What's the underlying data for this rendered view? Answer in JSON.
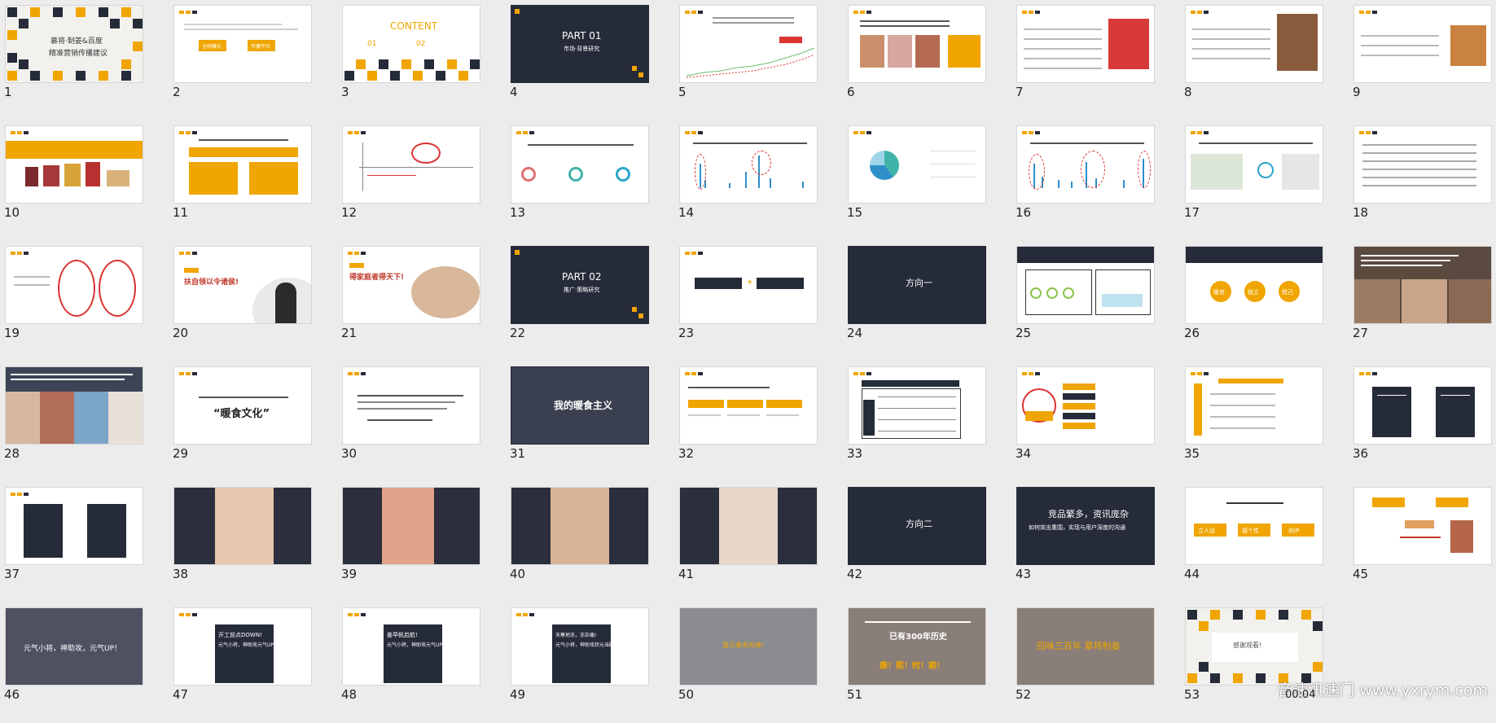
{
  "slides": [
    {
      "n": "1",
      "title": "慕将·制姜&百度",
      "subtitle": "精准营销传播建议"
    },
    {
      "n": "2",
      "a": "全网曝光",
      "b": "传播平台"
    },
    {
      "n": "3",
      "title": "CONTENT",
      "i1": "01",
      "i2": "02"
    },
    {
      "n": "4",
      "title": "PART 01",
      "subtitle": "市场·背景研究"
    },
    {
      "n": "5"
    },
    {
      "n": "6"
    },
    {
      "n": "7"
    },
    {
      "n": "8"
    },
    {
      "n": "9"
    },
    {
      "n": "10"
    },
    {
      "n": "11"
    },
    {
      "n": "12"
    },
    {
      "n": "13"
    },
    {
      "n": "14"
    },
    {
      "n": "15"
    },
    {
      "n": "16"
    },
    {
      "n": "17"
    },
    {
      "n": "18"
    },
    {
      "n": "19"
    },
    {
      "n": "20",
      "title": "扶自领以令诸侯!"
    },
    {
      "n": "21",
      "title": "得家庭者得天下!"
    },
    {
      "n": "22",
      "title": "PART 02",
      "subtitle": "推广·策略研究"
    },
    {
      "n": "23"
    },
    {
      "n": "24",
      "title": "方向一"
    },
    {
      "n": "25"
    },
    {
      "n": "26",
      "c1": "暖宫",
      "c2": "独立",
      "c3": "悦己"
    },
    {
      "n": "27"
    },
    {
      "n": "28"
    },
    {
      "n": "29",
      "title": "“暖食文化”"
    },
    {
      "n": "30"
    },
    {
      "n": "31",
      "title": "我的暖食主义"
    },
    {
      "n": "32"
    },
    {
      "n": "33"
    },
    {
      "n": "34"
    },
    {
      "n": "35"
    },
    {
      "n": "36"
    },
    {
      "n": "37"
    },
    {
      "n": "38"
    },
    {
      "n": "39"
    },
    {
      "n": "40"
    },
    {
      "n": "41"
    },
    {
      "n": "42",
      "title": "方向二"
    },
    {
      "n": "43",
      "title": "竞品繁多，资讯庞杂",
      "subtitle": "如何突出重围，实现与用户深度的沟通"
    },
    {
      "n": "44",
      "c1": "立人设",
      "c2": "接个性",
      "c3": "创IP"
    },
    {
      "n": "45"
    },
    {
      "n": "46",
      "title": "元气小将，神助攻，元气UP！"
    },
    {
      "n": "47",
      "title": "开工前点DOWN!",
      "subtitle": "元气小将，神助攻元气UP"
    },
    {
      "n": "48",
      "title": "姜早帆启航!",
      "subtitle": "元气小将，神助攻元气UP"
    },
    {
      "n": "49",
      "title": "天寒地冻，冻杂痛!",
      "subtitle": "元气小将，神助攻状元当殿，元气UP"
    },
    {
      "n": "50",
      "title": "喜迁基老的辣!"
    },
    {
      "n": "51",
      "title": "已有300年历史",
      "subtitle": "康！熙！时！期！"
    },
    {
      "n": "52",
      "title": "回味三百年 慕将制姜"
    },
    {
      "n": "53",
      "title": "感谢观看!"
    }
  ],
  "watermark": "音速讯速门 www.yxrym.com",
  "timer": "00:04",
  "colors": {
    "accent": "#f0a500",
    "dark": "#262b39",
    "bg": "#ececec"
  }
}
